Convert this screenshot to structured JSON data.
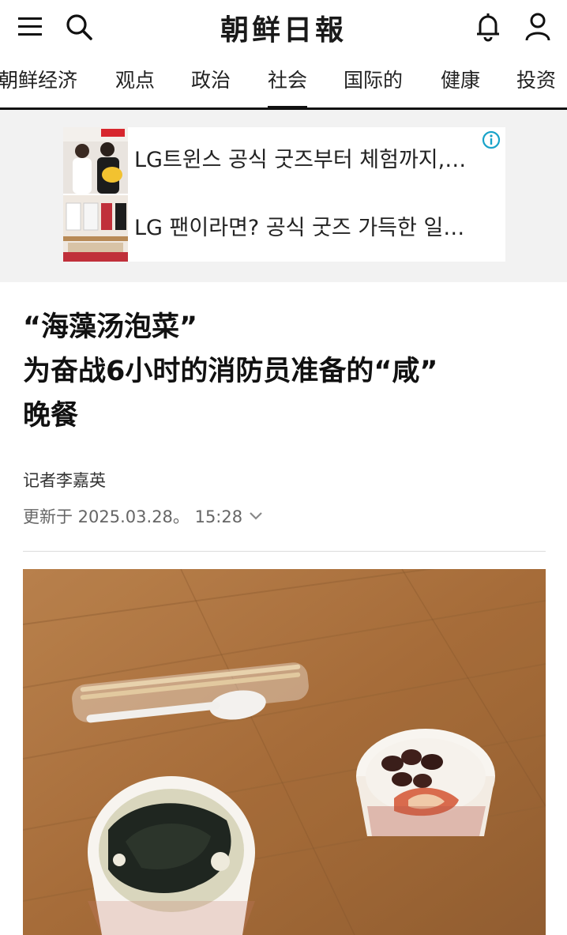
{
  "header": {
    "logo": "朝鲜日報",
    "icons": [
      "menu-icon",
      "search-icon",
      "bell-icon",
      "user-icon"
    ]
  },
  "nav": {
    "items": [
      "朝鲜经济",
      "观点",
      "政治",
      "社会",
      "国际的",
      "健康",
      "投资"
    ],
    "active": "社会"
  },
  "ad": {
    "items": [
      {
        "text": "LG트윈스 공식 굿즈부터 체험까지,…"
      },
      {
        "text": "LG 팬이라면? 공식 굿즈 가득한 일…"
      }
    ],
    "info_icon": "info-icon"
  },
  "article": {
    "title_line1": "“海藻汤泡菜”",
    "title_line2": "为奋战6小时的消防员准备的“咸”",
    "title_line3": "晚餐",
    "byline": "记者李嘉英",
    "updated": "更新于 2025.03.28。 15:28"
  },
  "colors": {
    "wood": "#a86a34",
    "accent_ad": "#19a3c9"
  }
}
